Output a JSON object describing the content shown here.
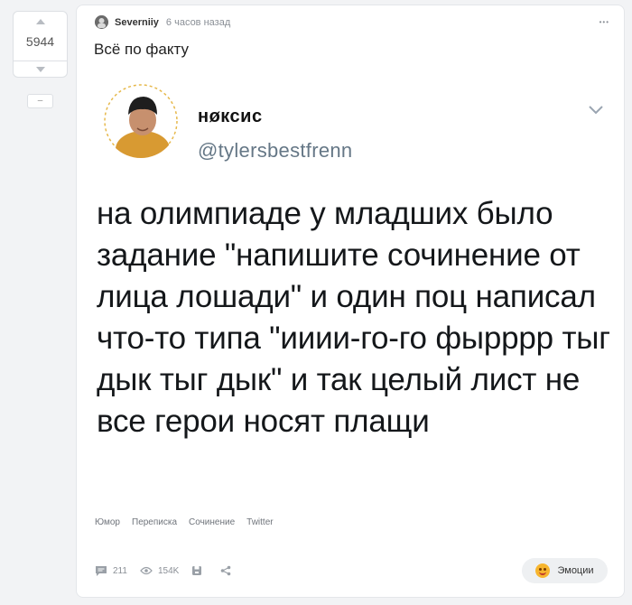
{
  "vote": {
    "score": "5944",
    "collapse_label": "–"
  },
  "post": {
    "author": "Severniiy",
    "time": "6 часов назад",
    "more": "•••",
    "title": "Всё по факту"
  },
  "tweet": {
    "name": "нøксис",
    "handle": "@tylersbestfrenn",
    "text": "на олимпиаде у младших было задание \"напишите сочинение от лица лошади\" и один поц написал что-то типа \"ииии-го-го фырррр тыг дык тыг дык\" и так целый лист не все герои носят плащи"
  },
  "tags": [
    "Юмор",
    "Переписка",
    "Сочинение",
    "Twitter"
  ],
  "footer": {
    "comments": "211",
    "views": "154K",
    "emotions_label": "Эмоции"
  },
  "icons": {
    "vote_up": "triangle-up-icon",
    "vote_down": "triangle-down-icon",
    "comments": "comment-icon",
    "views": "eye-icon",
    "save": "bookmark-icon",
    "share": "share-icon",
    "emotions": "smile-emoji-icon",
    "chevron": "chevron-down-icon"
  }
}
